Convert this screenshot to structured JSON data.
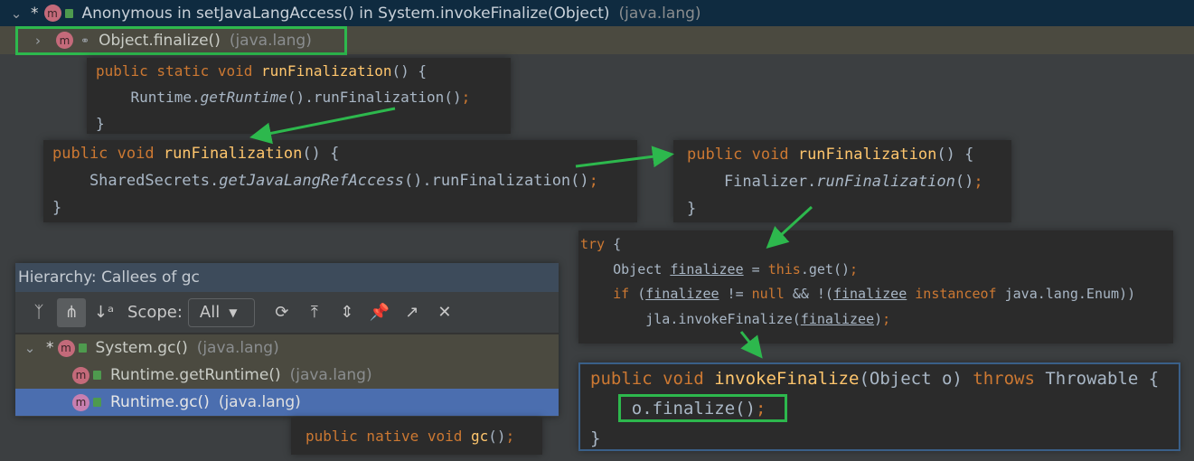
{
  "top_tree": {
    "row1": {
      "marker": "*",
      "icon": "m",
      "label": "Anonymous in setJavaLangAccess() in System.invokeFinalize(Object)",
      "package": "(java.lang)"
    },
    "row2": {
      "icon": "m",
      "label": "Object.finalize()",
      "package": "(java.lang)"
    }
  },
  "code_blocks": {
    "runtime_static": [
      [
        {
          "t": "public static void ",
          "c": "k"
        },
        {
          "t": "runFinalization",
          "c": "m"
        },
        {
          "t": "() {",
          "c": ""
        }
      ],
      [
        {
          "t": "    Runtime.",
          "c": ""
        },
        {
          "t": "getRuntime",
          "c": "i"
        },
        {
          "t": "().runFinalization()",
          "c": ""
        },
        {
          "t": ";",
          "c": "p"
        }
      ],
      [
        {
          "t": "}",
          "c": ""
        }
      ]
    ],
    "runtime_instance": [
      [
        {
          "t": "public void ",
          "c": "k"
        },
        {
          "t": "runFinalization",
          "c": "m"
        },
        {
          "t": "() {",
          "c": ""
        }
      ],
      [
        {
          "t": "    SharedSecrets.",
          "c": ""
        },
        {
          "t": "getJavaLangRefAccess",
          "c": "i"
        },
        {
          "t": "().runFinalization()",
          "c": ""
        },
        {
          "t": ";",
          "c": "p"
        }
      ],
      [
        {
          "t": "}",
          "c": ""
        }
      ]
    ],
    "jlra": [
      [
        {
          "t": "public void ",
          "c": "k"
        },
        {
          "t": "runFinalization",
          "c": "m"
        },
        {
          "t": "() {",
          "c": ""
        }
      ],
      [
        {
          "t": "    Finalizer.",
          "c": ""
        },
        {
          "t": "runFinalization",
          "c": "i"
        },
        {
          "t": "()",
          "c": ""
        },
        {
          "t": ";",
          "c": "p"
        }
      ],
      [
        {
          "t": "}",
          "c": ""
        }
      ]
    ],
    "finalizer_try": [
      [
        {
          "t": "try ",
          "c": "k"
        },
        {
          "t": "{",
          "c": ""
        }
      ],
      [
        {
          "t": "    Object ",
          "c": ""
        },
        {
          "t": "finalizee",
          "c": "u"
        },
        {
          "t": " = ",
          "c": ""
        },
        {
          "t": "this",
          "c": "k"
        },
        {
          "t": ".get()",
          "c": ""
        },
        {
          "t": ";",
          "c": "p"
        }
      ],
      [
        {
          "t": "    ",
          "c": ""
        },
        {
          "t": "if ",
          "c": "k"
        },
        {
          "t": "(",
          "c": ""
        },
        {
          "t": "finalizee",
          "c": "u"
        },
        {
          "t": " != ",
          "c": ""
        },
        {
          "t": "null ",
          "c": "k"
        },
        {
          "t": "&& !(",
          "c": ""
        },
        {
          "t": "finalizee",
          "c": "u"
        },
        {
          "t": " instanceof ",
          "c": "k"
        },
        {
          "t": "java.lang.Enum))",
          "c": ""
        }
      ],
      [
        {
          "t": "        jla.invokeFinalize(",
          "c": ""
        },
        {
          "t": "finalizee",
          "c": "u"
        },
        {
          "t": ")",
          "c": ""
        },
        {
          "t": ";",
          "c": "p"
        }
      ]
    ],
    "invoke_finalize": [
      [
        {
          "t": "public void ",
          "c": "k"
        },
        {
          "t": "invokeFinalize",
          "c": "m"
        },
        {
          "t": "(Object o) ",
          "c": ""
        },
        {
          "t": "throws ",
          "c": "k"
        },
        {
          "t": "Throwable {",
          "c": ""
        }
      ],
      [
        {
          "t": "    o.finalize()",
          "c": ""
        },
        {
          "t": ";",
          "c": "p"
        }
      ],
      [
        {
          "t": "}",
          "c": ""
        }
      ]
    ],
    "native_gc": [
      [
        {
          "t": "public native void ",
          "c": "k"
        },
        {
          "t": "gc",
          "c": "m"
        },
        {
          "t": "()",
          "c": ""
        },
        {
          "t": ";",
          "c": "p"
        }
      ]
    ]
  },
  "hierarchy": {
    "title": "Hierarchy:  Callees of gc",
    "scope_label": "Scope:",
    "scope_value": "All",
    "toolbar_icons": [
      "caller-hierarchy-icon",
      "callee-hierarchy-icon",
      "sort-alpha-icon",
      "refresh-icon",
      "expand-top-icon",
      "expand-all-icon",
      "pin-icon",
      "export-icon",
      "close-icon"
    ],
    "rows": [
      {
        "marker": "*",
        "icon": "m",
        "label": "System.gc()",
        "package": "(java.lang)"
      },
      {
        "icon": "m",
        "label": "Runtime.getRuntime()",
        "package": "(java.lang)"
      },
      {
        "icon": "m",
        "label": "Runtime.gc()",
        "package": "(java.lang)",
        "selected": true
      }
    ]
  },
  "colors": {
    "highlight": "#2db84d",
    "keyword": "#cc7832",
    "method": "#ffc66d",
    "selection": "#4b6eaf"
  }
}
